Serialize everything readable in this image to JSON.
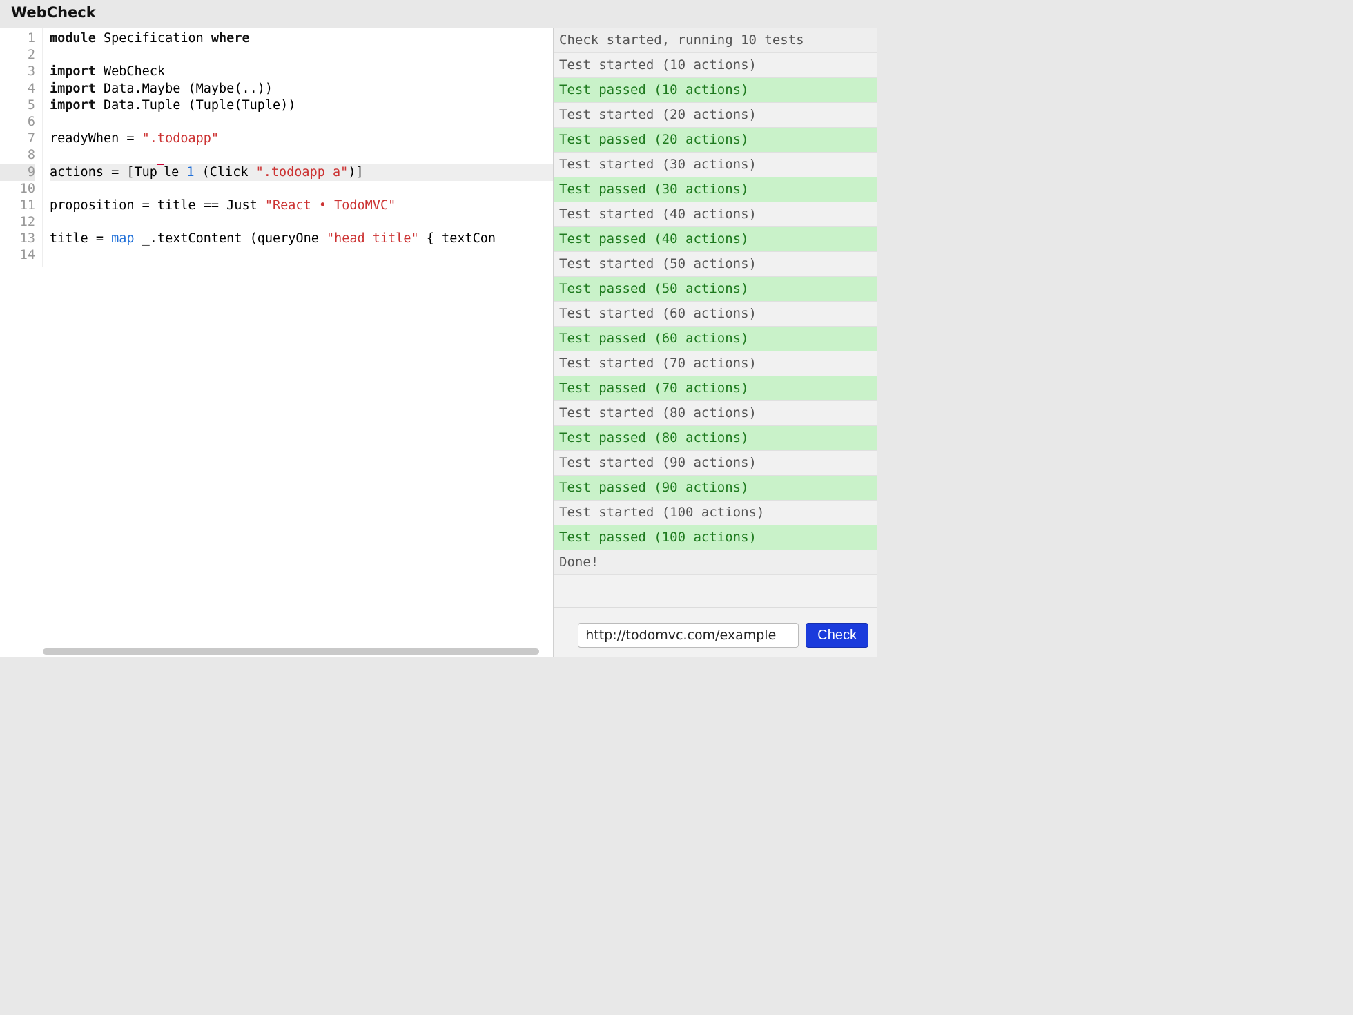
{
  "header": {
    "title": "WebCheck"
  },
  "editor": {
    "active_line": 9,
    "line_numbers": [
      1,
      2,
      3,
      4,
      5,
      6,
      7,
      8,
      9,
      10,
      11,
      12,
      13,
      14
    ],
    "lines": [
      {
        "n": 1,
        "segs": [
          {
            "t": "module ",
            "c": "kw"
          },
          {
            "t": "Specification "
          },
          {
            "t": "where",
            "c": "kw"
          }
        ]
      },
      {
        "n": 2,
        "segs": []
      },
      {
        "n": 3,
        "segs": [
          {
            "t": "import ",
            "c": "kw"
          },
          {
            "t": "WebCheck"
          }
        ]
      },
      {
        "n": 4,
        "segs": [
          {
            "t": "import ",
            "c": "kw"
          },
          {
            "t": "Data.Maybe (Maybe(..))"
          }
        ]
      },
      {
        "n": 5,
        "segs": [
          {
            "t": "import ",
            "c": "kw"
          },
          {
            "t": "Data.Tuple (Tuple(Tuple))"
          }
        ]
      },
      {
        "n": 6,
        "segs": []
      },
      {
        "n": 7,
        "segs": [
          {
            "t": "readyWhen = "
          },
          {
            "t": "\".todoapp\"",
            "c": "str"
          }
        ]
      },
      {
        "n": 8,
        "segs": []
      },
      {
        "n": 9,
        "segs": [
          {
            "t": "actions = [Tup"
          },
          {
            "cursor": true
          },
          {
            "t": "le "
          },
          {
            "t": "1",
            "c": "num"
          },
          {
            "t": " (Click "
          },
          {
            "t": "\".todoapp a\"",
            "c": "str"
          },
          {
            "t": ")]"
          }
        ]
      },
      {
        "n": 10,
        "segs": []
      },
      {
        "n": 11,
        "segs": [
          {
            "t": "proposition = title == Just "
          },
          {
            "t": "\"React • TodoMVC\"",
            "c": "str"
          }
        ]
      },
      {
        "n": 12,
        "segs": []
      },
      {
        "n": 13,
        "segs": [
          {
            "t": "title = "
          },
          {
            "t": "map",
            "c": "mapfn"
          },
          {
            "t": " _.textContent (queryOne "
          },
          {
            "t": "\"head title\"",
            "c": "str"
          },
          {
            "t": " { textCon"
          }
        ]
      },
      {
        "n": 14,
        "segs": []
      }
    ]
  },
  "results": [
    {
      "kind": "info",
      "text": "Check started, running 10 tests"
    },
    {
      "kind": "started",
      "text": "Test started (10 actions)"
    },
    {
      "kind": "passed",
      "text": "Test passed (10 actions)"
    },
    {
      "kind": "started",
      "text": "Test started (20 actions)"
    },
    {
      "kind": "passed",
      "text": "Test passed (20 actions)"
    },
    {
      "kind": "started",
      "text": "Test started (30 actions)"
    },
    {
      "kind": "passed",
      "text": "Test passed (30 actions)"
    },
    {
      "kind": "started",
      "text": "Test started (40 actions)"
    },
    {
      "kind": "passed",
      "text": "Test passed (40 actions)"
    },
    {
      "kind": "started",
      "text": "Test started (50 actions)"
    },
    {
      "kind": "passed",
      "text": "Test passed (50 actions)"
    },
    {
      "kind": "started",
      "text": "Test started (60 actions)"
    },
    {
      "kind": "passed",
      "text": "Test passed (60 actions)"
    },
    {
      "kind": "started",
      "text": "Test started (70 actions)"
    },
    {
      "kind": "passed",
      "text": "Test passed (70 actions)"
    },
    {
      "kind": "started",
      "text": "Test started (80 actions)"
    },
    {
      "kind": "passed",
      "text": "Test passed (80 actions)"
    },
    {
      "kind": "started",
      "text": "Test started (90 actions)"
    },
    {
      "kind": "passed",
      "text": "Test passed (90 actions)"
    },
    {
      "kind": "started",
      "text": "Test started (100 actions)"
    },
    {
      "kind": "passed",
      "text": "Test passed (100 actions)"
    },
    {
      "kind": "info",
      "text": "Done!"
    }
  ],
  "bottom": {
    "url_value": "http://todomvc.com/example",
    "check_label": "Check"
  }
}
